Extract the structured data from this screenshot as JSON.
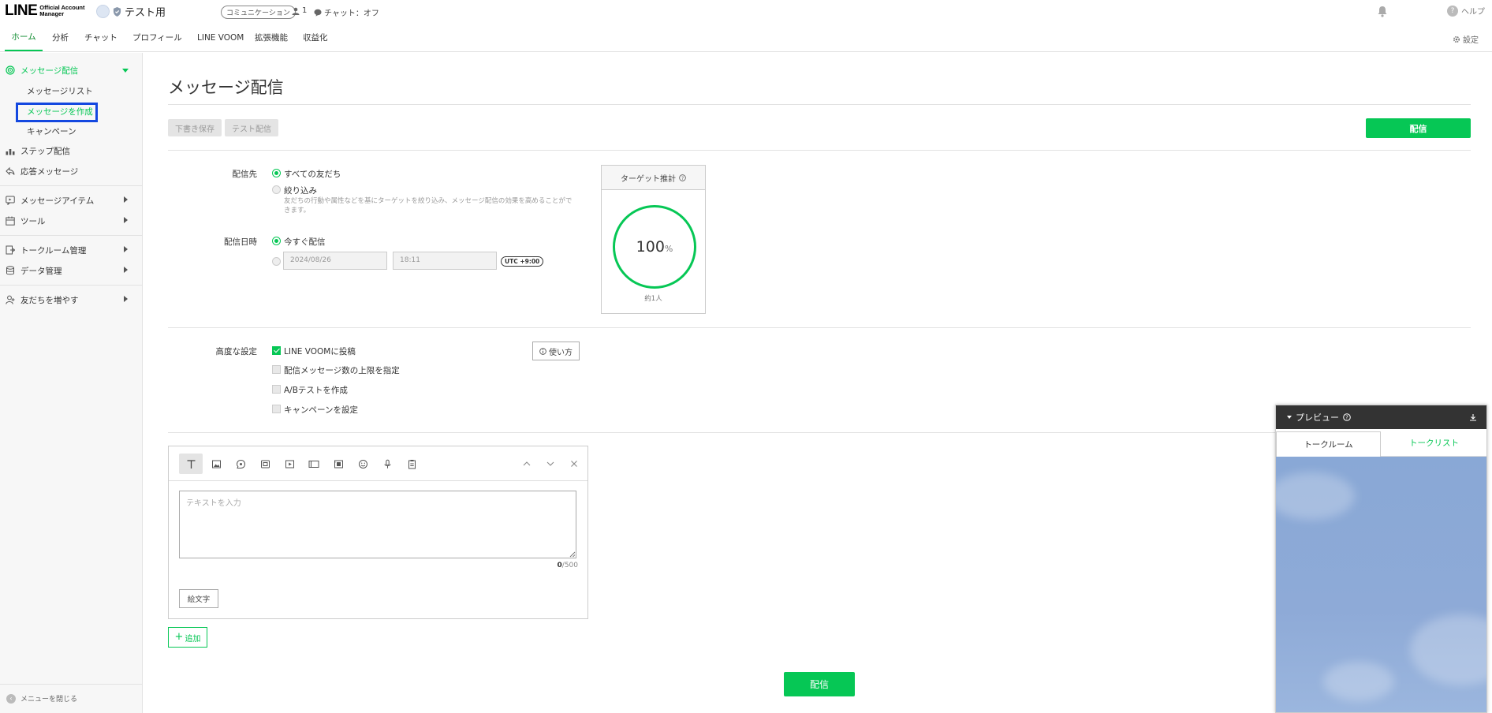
{
  "app": {
    "logo_main": "LINE",
    "logo_sub_1": "Official Account",
    "logo_sub_2": "Manager",
    "account_name": "テスト用",
    "account_type": "コミュニケーション",
    "friend_count": "1",
    "chat_status": "チャット：オフ",
    "help_label": "ヘルプ"
  },
  "nav": {
    "tabs": [
      {
        "label": "ホーム"
      },
      {
        "label": "分析"
      },
      {
        "label": "チャット"
      },
      {
        "label": "プロフィール"
      },
      {
        "label": "LINE VOOM"
      },
      {
        "label": "拡張機能"
      },
      {
        "label": "収益化"
      }
    ],
    "settings_label": "設定"
  },
  "sidebar": {
    "broadcast": "メッセージ配信",
    "sub_items": [
      "メッセージリスト",
      "メッセージを作成",
      "キャンペーン"
    ],
    "step": "ステップ配信",
    "auto_reply": "応答メッセージ",
    "message_items": "メッセージアイテム",
    "tools": "ツール",
    "talkroom": "トークルーム管理",
    "data": "データ管理",
    "friends": "友だちを増やす",
    "close_menu": "メニューを閉じる"
  },
  "page": {
    "title": "メッセージ配信",
    "save_draft": "下書き保存",
    "test_send": "テスト配信",
    "send": "配信"
  },
  "form": {
    "recipient_label": "配信先",
    "recipient_all": "すべての友だち",
    "recipient_filter": "絞り込み",
    "recipient_hint": "友だちの行動や属性などを基にターゲットを絞り込み、メッセージ配信の効果を高めることができます。",
    "date_label": "配信日時",
    "date_now": "今すぐ配信",
    "date_value": "2024/08/26",
    "time_value": "18:11",
    "utc": "UTC +9:00",
    "advanced_label": "高度な設定",
    "opt_voom": "LINE VOOMに投稿",
    "opt_limit": "配信メッセージ数の上限を指定",
    "opt_ab": "A/Bテストを作成",
    "opt_campaign": "キャンペーンを設定",
    "howto": "使い方"
  },
  "target": {
    "title": "ターゲット推計",
    "percent": "100",
    "percent_unit": "%",
    "people": "約1人"
  },
  "editor": {
    "placeholder": "テキストを入力",
    "count_current": "0",
    "count_max": "/500",
    "emoji_button": "絵文字",
    "add_button": "追加"
  },
  "preview": {
    "title": "プレビュー",
    "tab_talkroom": "トークルーム",
    "tab_talklist": "トークリスト"
  },
  "colors": {
    "brand_green": "#06c755",
    "highlight_box": "#1448e0",
    "preview_sky": "#89a8d6"
  }
}
